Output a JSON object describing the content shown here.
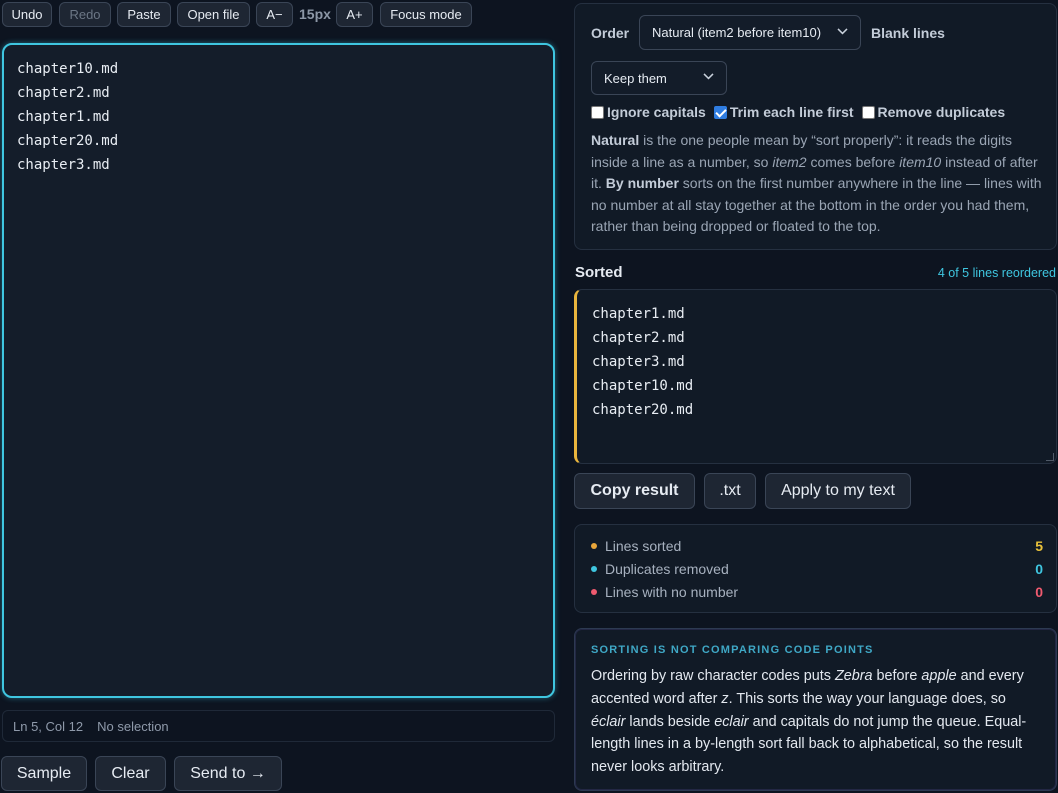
{
  "toolbar": {
    "undo": "Undo",
    "redo": "Redo",
    "paste": "Paste",
    "open_file": "Open file",
    "font_down": "A−",
    "font_size": "15px",
    "font_up": "A+",
    "focus_mode": "Focus mode"
  },
  "editor": {
    "lines": [
      "chapter10.md",
      "chapter2.md",
      "chapter1.md",
      "chapter20.md",
      "chapter3.md"
    ]
  },
  "status": {
    "position": "Ln 5, Col 12",
    "selection": "No selection"
  },
  "bottom_buttons": {
    "sample": "Sample",
    "clear": "Clear",
    "send_to": "Send to →"
  },
  "options": {
    "order_label": "Order",
    "order_value": "Natural (item2 before item10)",
    "blank_label": "Blank lines",
    "blank_value": "Keep them",
    "ignore_caps": "Ignore capitals",
    "ignore_caps_checked": false,
    "trim": "Trim each line first",
    "trim_checked": true,
    "remove_dupes": "Remove duplicates",
    "remove_dupes_checked": false,
    "help": {
      "natural_term": "Natural",
      "natural_text_1": " is the one people mean by “sort properly”: it reads the digits inside a line as a number, so ",
      "example_a": "item2",
      "natural_text_2": " comes before ",
      "example_b": "item10",
      "natural_text_3": " instead of after it. ",
      "bynum_term": "By number",
      "bynum_text": " sorts on the first number anywhere in the line — lines with no number at all stay together at the bottom in the order you had them, rather than being dropped or floated to the top."
    }
  },
  "result": {
    "title": "Sorted",
    "reordered": "4 of 5 lines reordered",
    "lines": [
      "chapter1.md",
      "chapter2.md",
      "chapter3.md",
      "chapter10.md",
      "chapter20.md"
    ]
  },
  "actions": {
    "copy": "Copy result",
    "txt": ".txt",
    "apply": "Apply to my text"
  },
  "stats": [
    {
      "label": "Lines sorted",
      "value": "5",
      "color": "#e9a63a"
    },
    {
      "label": "Duplicates removed",
      "value": "0",
      "color": "#3fc6e0"
    },
    {
      "label": "Lines with no number",
      "value": "0",
      "color": "#ef5a6f"
    }
  ],
  "note": {
    "title": "SORTING IS NOT COMPARING CODE POINTS",
    "t1": "Ordering by raw character codes puts ",
    "e1": "Zebra",
    "t2": " before ",
    "e2": "apple",
    "t3": " and every accented word after ",
    "e3": "z",
    "t4": ". This sorts the way your language does, so ",
    "e4": "éclair",
    "t5": " lands beside ",
    "e5": "eclair",
    "t6": " and capitals do not jump the queue. Equal-length lines in a by-length sort fall back to alphabetical, so the result never looks arbitrary."
  }
}
